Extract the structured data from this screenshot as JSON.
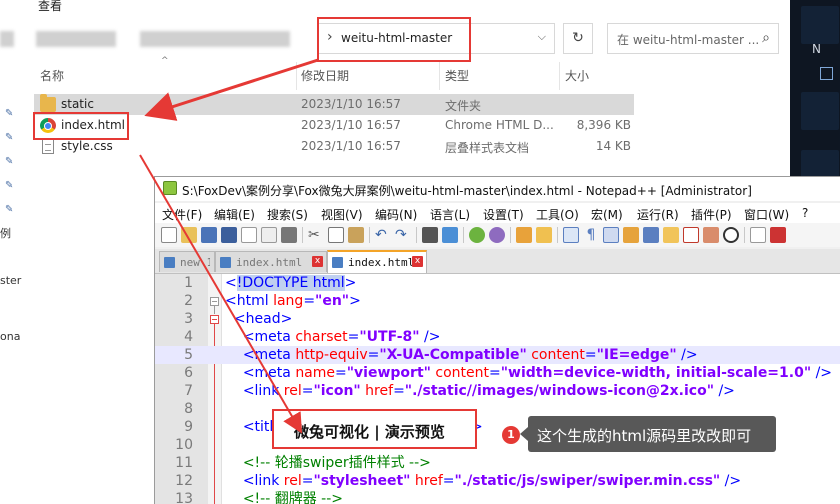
{
  "explorer": {
    "menu_view_label": "查看",
    "address_path": "weitu-html-master",
    "search_placeholder": "在 weitu-html-master ...",
    "columns": {
      "name": "名称",
      "date": "修改日期",
      "type": "类型",
      "size": "大小"
    },
    "files": [
      {
        "name": "static",
        "date": "2023/1/10 16:57",
        "type": "文件夹",
        "size": "",
        "icon": "folder-icon"
      },
      {
        "name": "index.html",
        "date": "2023/1/10 16:57",
        "type": "Chrome HTML D...",
        "size": "8,396 KB",
        "icon": "chrome-icon"
      },
      {
        "name": "style.css",
        "date": "2023/1/10 16:57",
        "type": "层叠样式表文档",
        "size": "14 KB",
        "icon": "css-file-icon"
      }
    ],
    "sidebar_cut_labels": [
      "例",
      "ster",
      "ona"
    ]
  },
  "right_panel": {
    "label": "N"
  },
  "notepad": {
    "title": "S:\\FoxDev\\案例分享\\Fox微兔大屏案例\\weitu-html-master\\index.html - Notepad++ [Administrator]",
    "menu": [
      "文件(F)",
      "编辑(E)",
      "搜索(S)",
      "视图(V)",
      "编码(N)",
      "语言(L)",
      "设置(T)",
      "工具(O)",
      "宏(M)",
      "运行(R)",
      "插件(P)",
      "窗口(W)",
      "?"
    ],
    "tabs": [
      {
        "label": "new 1"
      },
      {
        "label": "index.html"
      },
      {
        "label": "index.html"
      }
    ],
    "lines": [
      {
        "n": "1",
        "html": "<span class=\"k\">&lt;</span><span class=\"k doctype-hl\">!DOCTYPE html</span><span class=\"k\">&gt;</span>"
      },
      {
        "n": "2",
        "html": "<span class=\"k\">&lt;html </span><span class=\"a\">lang</span><span class=\"k\">=</span><span class=\"s\">\"en\"</span><span class=\"k\">&gt;</span>"
      },
      {
        "n": "3",
        "html": "  <span class=\"k\">&lt;head&gt;</span>"
      },
      {
        "n": "4",
        "html": "    <span class=\"k\">&lt;meta </span><span class=\"a\">charset</span><span class=\"k\">=</span><span class=\"s\">\"UTF-8\"</span><span class=\"k\"> /&gt;</span>"
      },
      {
        "n": "5",
        "html": "    <span class=\"k\">&lt;meta </span><span class=\"a\">http-equiv</span><span class=\"k\">=</span><span class=\"s\">\"X-UA-Compatible\"</span><span class=\"a\"> content</span><span class=\"k\">=</span><span class=\"s\">\"IE=edge\"</span><span class=\"k\"> /&gt;</span>"
      },
      {
        "n": "6",
        "html": "    <span class=\"k\">&lt;meta </span><span class=\"a\">name</span><span class=\"k\">=</span><span class=\"s\">\"viewport\"</span><span class=\"a\"> content</span><span class=\"k\">=</span><span class=\"s\">\"width=device-width, initial-scale=1.0\"</span><span class=\"k\"> /&gt;</span>"
      },
      {
        "n": "7",
        "html": "    <span class=\"k\">&lt;link </span><span class=\"a\">rel</span><span class=\"k\">=</span><span class=\"s\">\"icon\"</span><span class=\"a\"> href</span><span class=\"k\">=</span><span class=\"s\">\"./static//images/windows-icon@2x.ico\"</span><span class=\"k\"> /&gt;</span>"
      },
      {
        "n": "8",
        "html": ""
      },
      {
        "n": "9",
        "html": "    <span class=\"k\">&lt;title&gt;</span>                              <span class=\"k\">&lt;/title&gt;</span>"
      },
      {
        "n": "10",
        "html": ""
      },
      {
        "n": "11",
        "html": "    <span class=\"c\">&lt;!-- 轮播swiper插件样式 --&gt;</span>"
      },
      {
        "n": "12",
        "html": "    <span class=\"k\">&lt;link </span><span class=\"a\">rel</span><span class=\"k\">=</span><span class=\"s\">\"stylesheet\"</span><span class=\"a\"> href</span><span class=\"k\">=</span><span class=\"s\">\"./static/js/swiper/swiper.min.css\"</span><span class=\"k\"> /&gt;</span>"
      },
      {
        "n": "13",
        "html": "    <span class=\"c\">&lt;!-- 翻牌器 --&gt;</span>"
      }
    ],
    "title_text": "微兔可视化 | 演示预览"
  },
  "annotation": {
    "badge": "1",
    "callout": "这个生成的html源码里改改即可",
    "accent": "#e53935"
  }
}
